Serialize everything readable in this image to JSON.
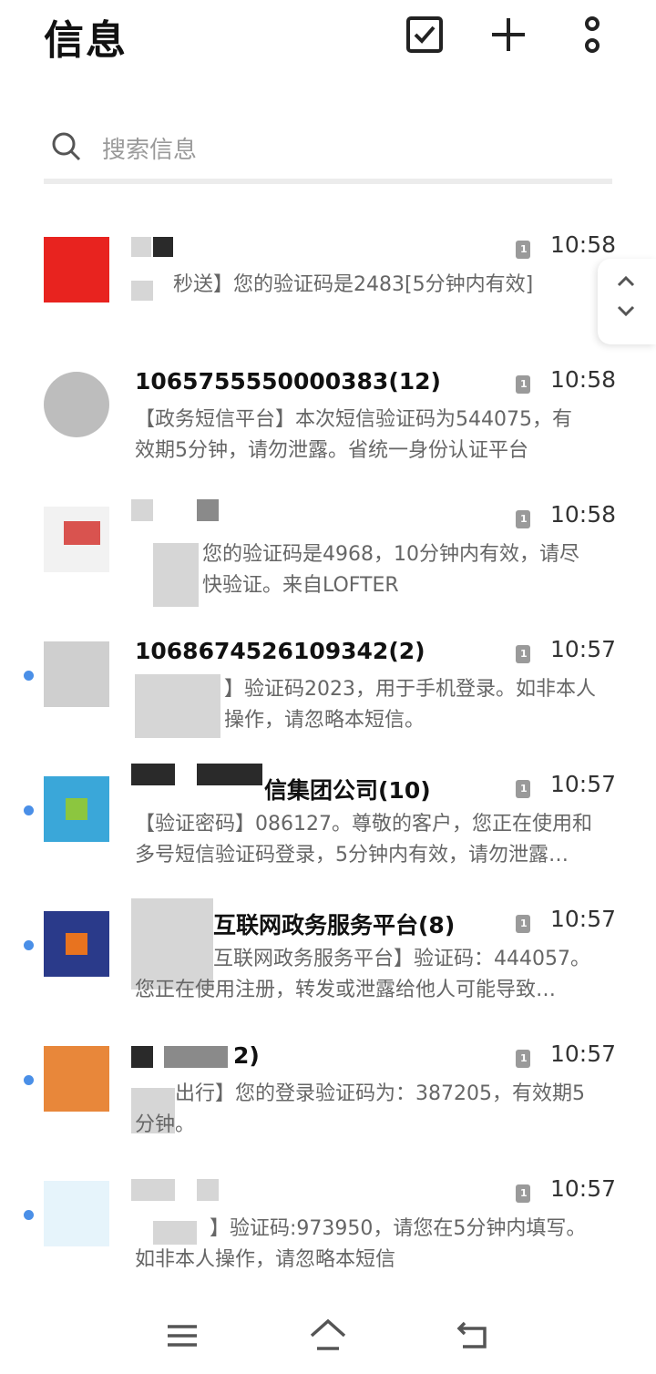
{
  "header": {
    "title": "信息",
    "icons": [
      "select-checkbox-icon",
      "plus-icon",
      "more-vertical-icon"
    ]
  },
  "search": {
    "placeholder": "搜索信息"
  },
  "messages": [
    {
      "sender": "",
      "preview_line1": "秒送】您的验证码是2483[5分钟内有效]",
      "preview_line2": "",
      "time": "10:58",
      "sim": "1",
      "unread": false,
      "avatar_color": "#e8231f"
    },
    {
      "sender": "1065755550000383(12)",
      "preview_line1": "【政务短信平台】本次短信验证码为544075，有",
      "preview_line2": "效期5分钟，请勿泄露。省统一身份认证平台",
      "time": "10:58",
      "sim": "1",
      "unread": false,
      "avatar_color": "#bdbdbd"
    },
    {
      "sender": "",
      "preview_line1": "您的验证码是4968，10分钟内有效，请尽",
      "preview_line2": "快验证。来自LOFTER",
      "time": "10:58",
      "sim": "1",
      "unread": false,
      "avatar_color": "#d9534f"
    },
    {
      "sender": "1068674526109342(2)",
      "preview_line1": "】验证码2023，用于手机登录。如非本人",
      "preview_line2": "操作，请忽略本短信。",
      "time": "10:57",
      "sim": "1",
      "unread": true,
      "avatar_color": "#cfcfcf"
    },
    {
      "sender": "信集团公司(10)",
      "preview_line1": "【验证密码】086127。尊敬的客户，您正在使用和",
      "preview_line2": "多号短信验证码登录，5分钟内有效，请勿泄露…",
      "time": "10:57",
      "sim": "1",
      "unread": true,
      "avatar_color": "#3aa7d9"
    },
    {
      "sender": "互联网政务服务平台(8)",
      "preview_line1": "互联网政务服务平台】验证码：444057。",
      "preview_line2": "您正在使用注册，转发或泄露给他人可能导致…",
      "time": "10:57",
      "sim": "1",
      "unread": true,
      "avatar_color": "#2a3a8a"
    },
    {
      "sender": "2)",
      "preview_line1": "出行】您的登录验证码为：387205，有效期5",
      "preview_line2": "分钟。",
      "time": "10:57",
      "sim": "1",
      "unread": true,
      "avatar_color": "#e8873a"
    },
    {
      "sender": "",
      "preview_line1": "】验证码:973950，请您在5分钟内填写。",
      "preview_line2": "如非本人操作，请忽略本短信",
      "time": "10:57",
      "sim": "1",
      "unread": true,
      "avatar_color": "#e6f4fb"
    }
  ],
  "navbar": {
    "icons": [
      "menu-icon",
      "home-icon",
      "back-icon"
    ]
  }
}
